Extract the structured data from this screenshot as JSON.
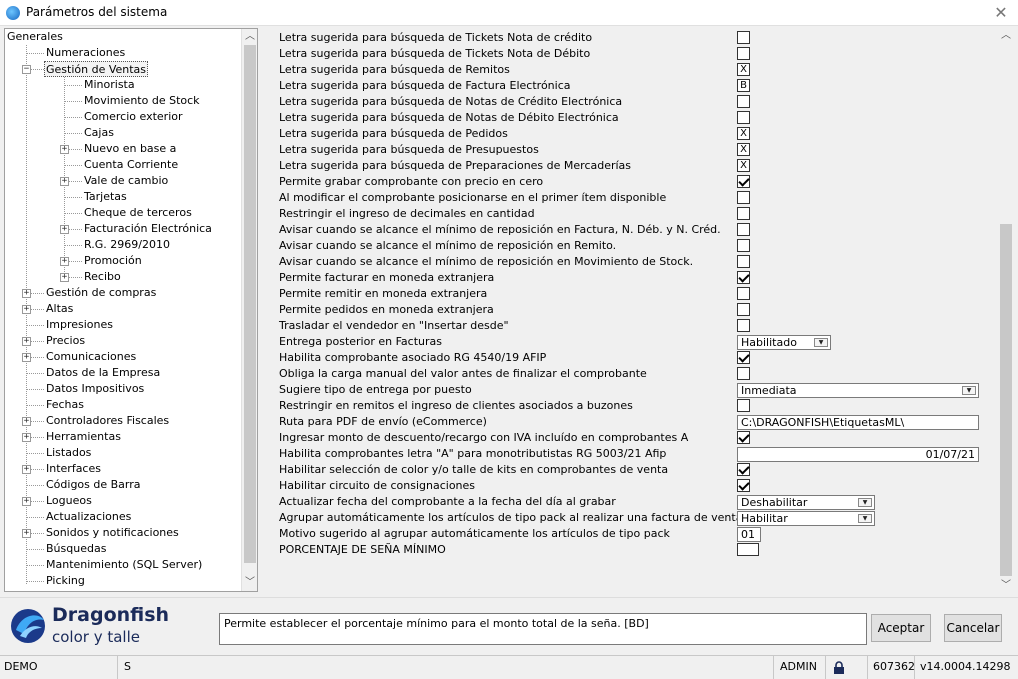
{
  "window": {
    "title": "Parámetros del sistema"
  },
  "tree": {
    "items": [
      {
        "label": "Generales",
        "level": 0,
        "expander": ""
      },
      {
        "label": "Numeraciones",
        "level": 1,
        "expander": ""
      },
      {
        "label": "Gestión de Ventas",
        "level": 1,
        "expander": "minus",
        "selected": true
      },
      {
        "label": "Minorista",
        "level": 2,
        "expander": ""
      },
      {
        "label": "Movimiento de Stock",
        "level": 2,
        "expander": ""
      },
      {
        "label": "Comercio exterior",
        "level": 2,
        "expander": ""
      },
      {
        "label": "Cajas",
        "level": 2,
        "expander": ""
      },
      {
        "label": "Nuevo en base a",
        "level": 2,
        "expander": "plus"
      },
      {
        "label": "Cuenta Corriente",
        "level": 2,
        "expander": ""
      },
      {
        "label": "Vale de cambio",
        "level": 2,
        "expander": "plus"
      },
      {
        "label": "Tarjetas",
        "level": 2,
        "expander": ""
      },
      {
        "label": "Cheque de terceros",
        "level": 2,
        "expander": ""
      },
      {
        "label": "Facturación Electrónica",
        "level": 2,
        "expander": "plus"
      },
      {
        "label": "R.G. 2969/2010",
        "level": 2,
        "expander": ""
      },
      {
        "label": "Promoción",
        "level": 2,
        "expander": "plus"
      },
      {
        "label": "Recibo",
        "level": 2,
        "expander": "plus"
      },
      {
        "label": "Gestión de compras",
        "level": 1,
        "expander": "plus"
      },
      {
        "label": "Altas",
        "level": 1,
        "expander": "plus"
      },
      {
        "label": "Impresiones",
        "level": 1,
        "expander": ""
      },
      {
        "label": "Precios",
        "level": 1,
        "expander": "plus"
      },
      {
        "label": "Comunicaciones",
        "level": 1,
        "expander": "plus"
      },
      {
        "label": "Datos de la Empresa",
        "level": 1,
        "expander": ""
      },
      {
        "label": "Datos Impositivos",
        "level": 1,
        "expander": ""
      },
      {
        "label": "Fechas",
        "level": 1,
        "expander": ""
      },
      {
        "label": "Controladores Fiscales",
        "level": 1,
        "expander": "plus"
      },
      {
        "label": "Herramientas",
        "level": 1,
        "expander": "plus"
      },
      {
        "label": "Listados",
        "level": 1,
        "expander": ""
      },
      {
        "label": "Interfaces",
        "level": 1,
        "expander": "plus"
      },
      {
        "label": "Códigos de Barra",
        "level": 1,
        "expander": ""
      },
      {
        "label": "Logueos",
        "level": 1,
        "expander": "plus"
      },
      {
        "label": "Actualizaciones",
        "level": 1,
        "expander": ""
      },
      {
        "label": "Sonidos y notificaciones",
        "level": 1,
        "expander": "plus"
      },
      {
        "label": "Búsquedas",
        "level": 1,
        "expander": ""
      },
      {
        "label": "Mantenimiento (SQL Server)",
        "level": 1,
        "expander": ""
      },
      {
        "label": "Picking",
        "level": 1,
        "expander": ""
      }
    ]
  },
  "settings": [
    {
      "label": "Letra sugerida para búsqueda de Tickets Nota de crédito",
      "type": "letter",
      "value": ""
    },
    {
      "label": "Letra sugerida para búsqueda de Tickets Nota de Débito",
      "type": "letter",
      "value": ""
    },
    {
      "label": "Letra sugerida para búsqueda de Remitos",
      "type": "letter",
      "value": "X"
    },
    {
      "label": "Letra sugerida para búsqueda de Factura Electrónica",
      "type": "letter",
      "value": "B"
    },
    {
      "label": "Letra sugerida para búsqueda de Notas de Crédito Electrónica",
      "type": "letter",
      "value": ""
    },
    {
      "label": "Letra sugerida para búsqueda de Notas de Débito Electrónica",
      "type": "letter",
      "value": ""
    },
    {
      "label": "Letra sugerida para búsqueda de Pedidos",
      "type": "letter",
      "value": "X"
    },
    {
      "label": "Letra sugerida para búsqueda de Presupuestos",
      "type": "letter",
      "value": "X"
    },
    {
      "label": "Letra sugerida para búsqueda de Preparaciones de Mercaderías",
      "type": "letter",
      "value": "X"
    },
    {
      "label": "Permite grabar comprobante con precio en cero",
      "type": "check",
      "checked": true
    },
    {
      "label": "Al modificar el comprobante posicionarse en el primer ítem disponible",
      "type": "check",
      "checked": false
    },
    {
      "label": "Restringir el ingreso de decimales en cantidad",
      "type": "check",
      "checked": false
    },
    {
      "label": "Avisar cuando se alcance el mínimo de reposición en Factura, N. Déb. y N. Créd.",
      "type": "check",
      "checked": false
    },
    {
      "label": "Avisar cuando se alcance el mínimo de reposición en Remito.",
      "type": "check",
      "checked": false
    },
    {
      "label": "Avisar cuando se alcance el mínimo de reposición en Movimiento de Stock.",
      "type": "check",
      "checked": false
    },
    {
      "label": "Permite facturar en moneda extranjera",
      "type": "check",
      "checked": true
    },
    {
      "label": "Permite remitir en moneda extranjera",
      "type": "check",
      "checked": false
    },
    {
      "label": "Permite pedidos en moneda extranjera",
      "type": "check",
      "checked": false
    },
    {
      "label": "Trasladar el vendedor en \"Insertar desde\"",
      "type": "check",
      "checked": false
    },
    {
      "label": "Entrega posterior en Facturas",
      "type": "combo",
      "value": "Habilitado",
      "width": "small"
    },
    {
      "label": "Habilita comprobante asociado RG 4540/19 AFIP",
      "type": "check",
      "checked": true
    },
    {
      "label": "Obliga la carga manual del valor antes de finalizar el comprobante",
      "type": "check",
      "checked": false
    },
    {
      "label": "Sugiere tipo de entrega por puesto",
      "type": "combo",
      "value": "Inmediata",
      "width": "wide"
    },
    {
      "label": "Restringir en remitos el ingreso de clientes asociados a buzones",
      "type": "check",
      "checked": false
    },
    {
      "label": "Ruta para PDF de envío (eCommerce)",
      "type": "text",
      "value": "C:\\DRAGONFISH\\EtiquetasML\\"
    },
    {
      "label": "Ingresar monto de descuento/recargo con IVA incluído en comprobantes A",
      "type": "check",
      "checked": true
    },
    {
      "label": "Habilita comprobantes letra \"A\" para monotributistas RG 5003/21 Afip",
      "type": "date",
      "value": "01/07/21"
    },
    {
      "label": "Habilitar selección de color y/o talle de kits en comprobantes de venta",
      "type": "check",
      "checked": true
    },
    {
      "label": "Habilitar circuito de consignaciones",
      "type": "check",
      "checked": true
    },
    {
      "label": "Actualizar fecha del comprobante a la fecha del día al grabar",
      "type": "combo",
      "value": "Deshabilitar",
      "width": "mid"
    },
    {
      "label": "Agrupar automáticamente los artículos de tipo pack al realizar una factura de venta",
      "type": "combo",
      "value": "Habilitar",
      "width": "mid"
    },
    {
      "label": "Motivo sugerido al agrupar automáticamente los artículos de tipo pack",
      "type": "short",
      "value": "01"
    },
    {
      "label": "PORCENTAJE DE SEÑA MÍNIMO",
      "type": "letter",
      "value": "",
      "wide": true
    }
  ],
  "brand": {
    "name": "Dragonfish",
    "tagline": "color y talle"
  },
  "description": "Permite establecer el porcentaje mínimo para el monto total de la seña. [BD]",
  "buttons": {
    "accept": "Aceptar",
    "cancel": "Cancelar"
  },
  "statusbar": {
    "db": "DEMO",
    "mode": "S",
    "user": "ADMIN",
    "serial": "607362",
    "version": "v14.0004.14298"
  },
  "colors": {
    "brand_navy": "#1b2b5a",
    "brand_blue": "#2b7bd6"
  }
}
